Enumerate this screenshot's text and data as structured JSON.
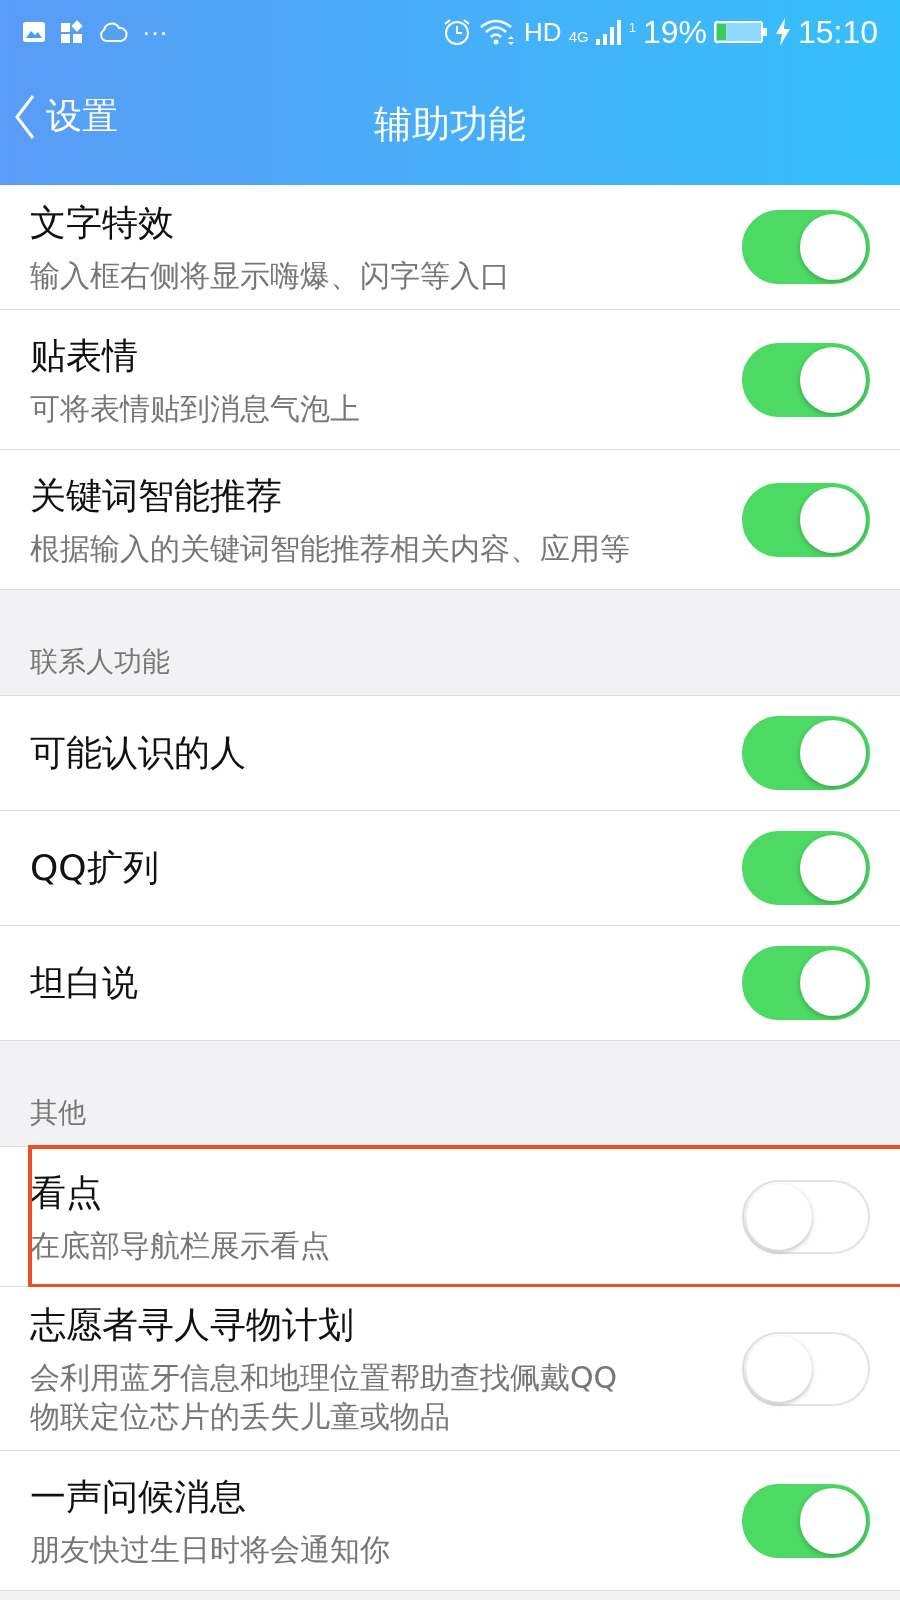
{
  "status_bar": {
    "more": "···",
    "network": "HD",
    "network_type": "4G",
    "sim": "1",
    "battery": "19%",
    "time": "15:10"
  },
  "nav": {
    "back_label": "设置",
    "title": "辅助功能"
  },
  "sections": [
    {
      "items": [
        {
          "title": "文字特效",
          "subtitle": "输入框右侧将显示嗨爆、闪字等入口",
          "on": true,
          "highlighted": false
        },
        {
          "title": "贴表情",
          "subtitle": "可将表情贴到消息气泡上",
          "on": true,
          "highlighted": false
        },
        {
          "title": "关键词智能推荐",
          "subtitle": "根据输入的关键词智能推荐相关内容、应用等",
          "on": true,
          "highlighted": false
        }
      ]
    },
    {
      "header": "联系人功能",
      "items": [
        {
          "title": "可能认识的人",
          "on": true,
          "highlighted": false
        },
        {
          "title": "QQ扩列",
          "on": true,
          "highlighted": false
        },
        {
          "title": "坦白说",
          "on": true,
          "highlighted": false
        }
      ]
    },
    {
      "header": "其他",
      "items": [
        {
          "title": "看点",
          "subtitle": "在底部导航栏展示看点",
          "on": false,
          "highlighted": true
        },
        {
          "title": "志愿者寻人寻物计划",
          "subtitle": "会利用蓝牙信息和地理位置帮助查找佩戴QQ物联定位芯片的丢失儿童或物品",
          "on": false,
          "highlighted": false
        },
        {
          "title": "一声问候消息",
          "subtitle": "朋友快过生日时将会通知你",
          "on": true,
          "highlighted": false
        }
      ]
    }
  ]
}
